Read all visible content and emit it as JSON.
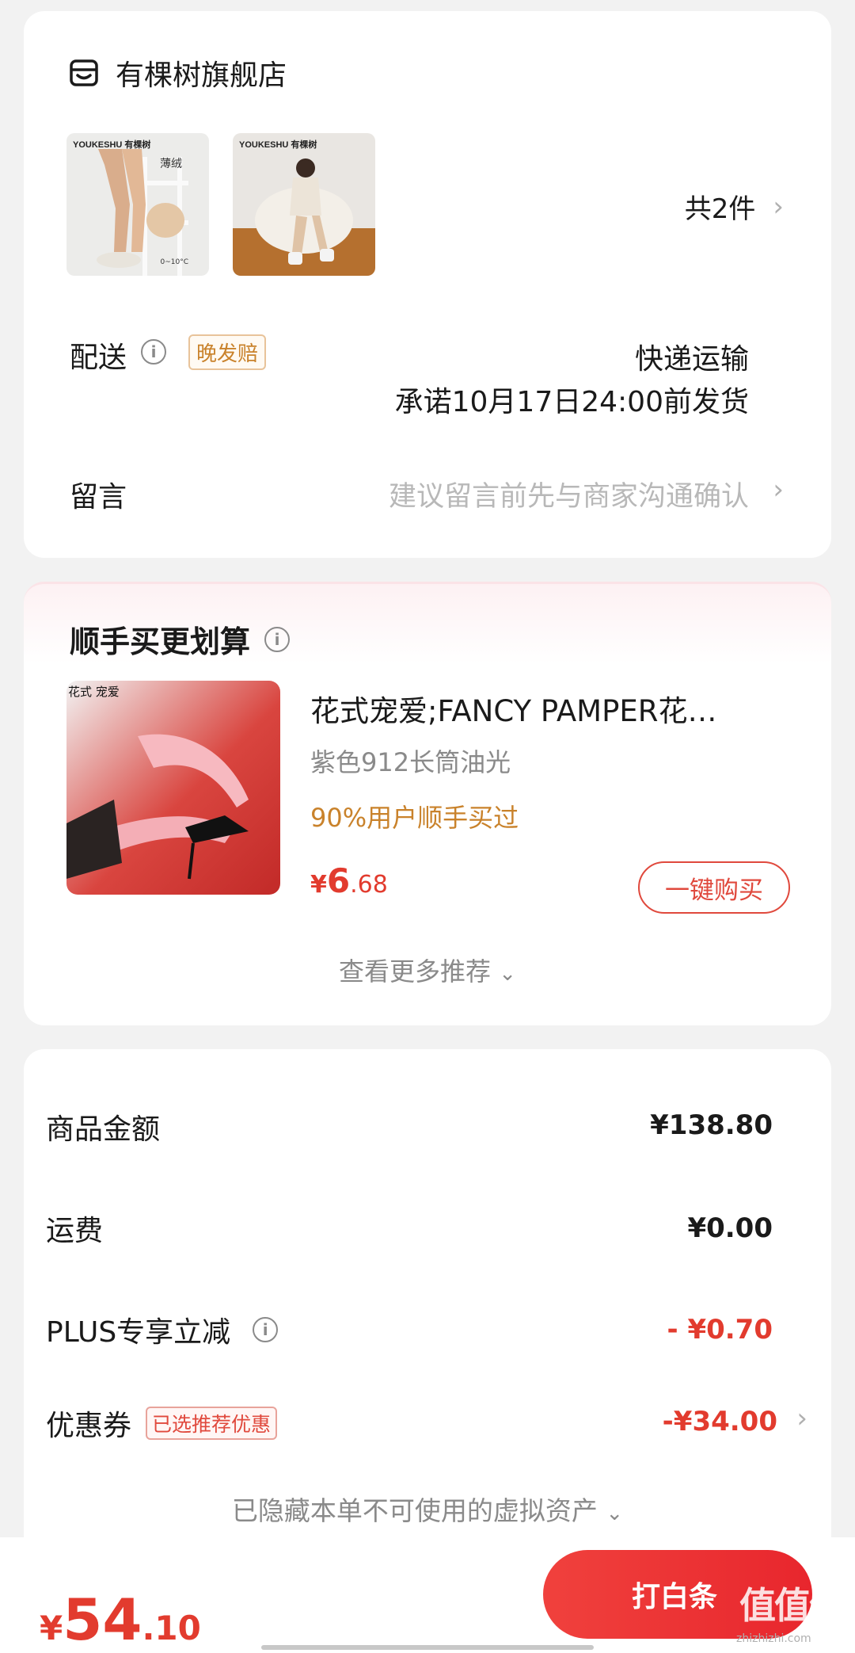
{
  "shop": {
    "name": "有棵树旗舰店",
    "thumb1": {
      "brand": "YOUKESHU 有棵树",
      "tag": "薄绒",
      "temp": "0~10°C"
    },
    "thumb2": {
      "brand": "YOUKESHU 有棵树"
    },
    "count": "共2件",
    "delivery_label": "配送",
    "late_badge": "晚发赔",
    "ship_method": "快递运输",
    "ship_promise": "承诺10月17日24:00前发货",
    "note_label": "留言",
    "note_placeholder": "建议留言前先与商家沟通确认"
  },
  "recommend": {
    "title": "顺手买更划算",
    "img_tag": "花式 宠爱",
    "product_name": "花式宠爱;FANCY PAMPER花…",
    "spec": "紫色912长筒油光",
    "social": "90%用户顺手买过",
    "price_currency": "¥",
    "price_int": "6",
    "price_dec": ".68",
    "buy_label": "一键购买",
    "more_label": "查看更多推荐"
  },
  "totals": {
    "goods_label": "商品金额",
    "goods_value": "¥138.80",
    "freight_label": "运费",
    "freight_value": "¥0.00",
    "plus_label": "PLUS专享立减",
    "plus_value": "- ¥0.70",
    "coupon_label": "优惠券",
    "coupon_badge": "已选推荐优惠",
    "coupon_value": "-¥34.00",
    "hidden_label": "已隐藏本单不可使用的虚拟资产"
  },
  "bottom": {
    "currency": "¥",
    "total_int": "54",
    "total_dec": ".10",
    "pay_label": "打白条",
    "watermark": "值值值",
    "watermark_sub": "zhizhizhi.com"
  },
  "colors": {
    "accent_red": "#e23b2e",
    "badge_orange": "#c9822b",
    "muted_gray": "#8a8a8a"
  },
  "icons": [
    "store-icon",
    "info-icon",
    "chevron-right-icon",
    "chevron-down-icon"
  ]
}
